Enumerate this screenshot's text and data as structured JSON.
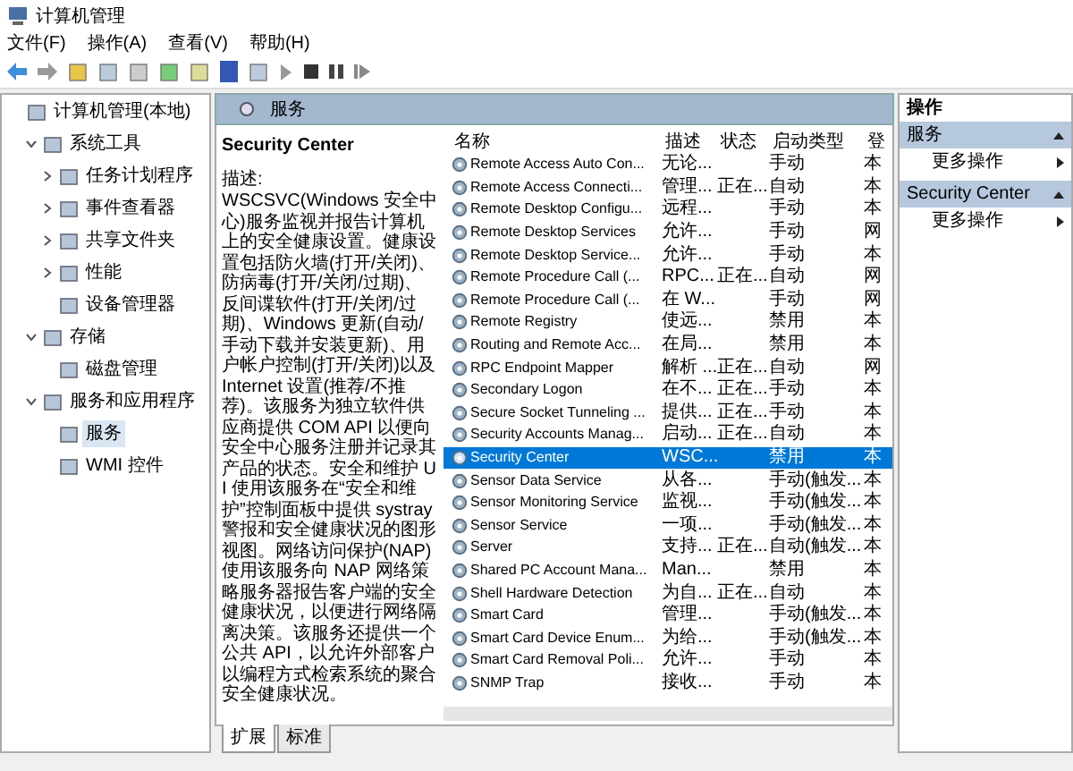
{
  "window": {
    "title": "计算机管理"
  },
  "menu": [
    "文件(F)",
    "操作(A)",
    "查看(V)",
    "帮助(H)"
  ],
  "tree": [
    {
      "label": "计算机管理(本地)",
      "selected": false,
      "children": [
        {
          "label": "系统工具",
          "expanded": true,
          "selected": false,
          "children": [
            {
              "label": "任务计划程序",
              "expanded": false,
              "selected": false
            },
            {
              "label": "事件查看器",
              "expanded": false,
              "selected": false
            },
            {
              "label": "共享文件夹",
              "expanded": false,
              "selected": false
            },
            {
              "label": "性能",
              "expanded": false,
              "selected": false
            },
            {
              "label": "设备管理器",
              "selected": false
            }
          ]
        },
        {
          "label": "存储",
          "expanded": true,
          "selected": false,
          "children": [
            {
              "label": "磁盘管理",
              "selected": false
            }
          ]
        },
        {
          "label": "服务和应用程序",
          "expanded": true,
          "selected": false,
          "children": [
            {
              "label": "服务",
              "selected": true
            },
            {
              "label": "WMI 控件",
              "selected": false
            }
          ]
        }
      ]
    }
  ],
  "panel": {
    "title": "服务"
  },
  "detail": {
    "name": "Security Center",
    "label": "描述:",
    "description": "WSCSVC(Windows 安全中心)服务监视并报告计算机上的安全健康设置。健康设置包括防火墙(打开/关闭)、防病毒(打开/关闭/过期)、反间谍软件(打开/关闭/过期)、Windows 更新(自动/手动下载并安装更新)、用户帐户控制(打开/关闭)以及 Internet 设置(推荐/不推荐)。该服务为独立软件供应商提供 COM API 以便向安全中心服务注册并记录其产品的状态。安全和维护 UI 使用该服务在“安全和维护”控制面板中提供 systray 警报和安全健康状况的图形视图。网络访问保护(NAP)使用该服务向 NAP 网络策略服务器报告客户端的安全健康状况，以便进行网络隔离决策。该服务还提供一个公共 API，以允许外部客户以编程方式检索系统的聚合安全健康状况。"
  },
  "columns": [
    "名称",
    "描述",
    "状态",
    "启动类型",
    "登"
  ],
  "rows": [
    {
      "name": "Remote Access Auto Con...",
      "description": "无论...",
      "status": "",
      "startup": "手动",
      "logon": "本",
      "selected": false
    },
    {
      "name": "Remote Access Connecti...",
      "description": "管理...",
      "status": "正在...",
      "startup": "自动",
      "logon": "本",
      "selected": false
    },
    {
      "name": "Remote Desktop Configu...",
      "description": "远程...",
      "status": "",
      "startup": "手动",
      "logon": "本",
      "selected": false
    },
    {
      "name": "Remote Desktop Services",
      "description": "允许...",
      "status": "",
      "startup": "手动",
      "logon": "网",
      "selected": false
    },
    {
      "name": "Remote Desktop Service...",
      "description": "允许...",
      "status": "",
      "startup": "手动",
      "logon": "本",
      "selected": false
    },
    {
      "name": "Remote Procedure Call (...",
      "description": "RPC...",
      "status": "正在...",
      "startup": "自动",
      "logon": "网",
      "selected": false
    },
    {
      "name": "Remote Procedure Call (...",
      "description": "在 W...",
      "status": "",
      "startup": "手动",
      "logon": "网",
      "selected": false
    },
    {
      "name": "Remote Registry",
      "description": "使远...",
      "status": "",
      "startup": "禁用",
      "logon": "本",
      "selected": false
    },
    {
      "name": "Routing and Remote Acc...",
      "description": "在局...",
      "status": "",
      "startup": "禁用",
      "logon": "本",
      "selected": false
    },
    {
      "name": "RPC Endpoint Mapper",
      "description": "解析 ...",
      "status": "正在...",
      "startup": "自动",
      "logon": "网",
      "selected": false
    },
    {
      "name": "Secondary Logon",
      "description": "在不...",
      "status": "正在...",
      "startup": "手动",
      "logon": "本",
      "selected": false
    },
    {
      "name": "Secure Socket Tunneling ...",
      "description": "提供...",
      "status": "正在...",
      "startup": "手动",
      "logon": "本",
      "selected": false
    },
    {
      "name": "Security Accounts Manag...",
      "description": "启动...",
      "status": "正在...",
      "startup": "自动",
      "logon": "本",
      "selected": false
    },
    {
      "name": "Security Center",
      "description": "WSC...",
      "status": "",
      "startup": "禁用",
      "logon": "本",
      "selected": true
    },
    {
      "name": "Sensor Data Service",
      "description": "从各...",
      "status": "",
      "startup": "手动(触发...",
      "logon": "本",
      "selected": false
    },
    {
      "name": "Sensor Monitoring Service",
      "description": "监视...",
      "status": "",
      "startup": "手动(触发...",
      "logon": "本",
      "selected": false
    },
    {
      "name": "Sensor Service",
      "description": "一项...",
      "status": "",
      "startup": "手动(触发...",
      "logon": "本",
      "selected": false
    },
    {
      "name": "Server",
      "description": "支持...",
      "status": "正在...",
      "startup": "自动(触发...",
      "logon": "本",
      "selected": false
    },
    {
      "name": "Shared PC Account Mana...",
      "description": "Man...",
      "status": "",
      "startup": "禁用",
      "logon": "本",
      "selected": false
    },
    {
      "name": "Shell Hardware Detection",
      "description": "为自...",
      "status": "正在...",
      "startup": "自动",
      "logon": "本",
      "selected": false
    },
    {
      "name": "Smart Card",
      "description": "管理...",
      "status": "",
      "startup": "手动(触发...",
      "logon": "本",
      "selected": false
    },
    {
      "name": "Smart Card Device Enum...",
      "description": "为给...",
      "status": "",
      "startup": "手动(触发...",
      "logon": "本",
      "selected": false
    },
    {
      "name": "Smart Card Removal Poli...",
      "description": "允许...",
      "status": "",
      "startup": "手动",
      "logon": "本",
      "selected": false
    },
    {
      "name": "SNMP Trap",
      "description": "接收...",
      "status": "",
      "startup": "手动",
      "logon": "本",
      "selected": false
    }
  ],
  "tabs": [
    {
      "label": "扩展",
      "selected": true
    },
    {
      "label": "标准",
      "selected": false
    }
  ],
  "actions": {
    "title": "操作",
    "sections": [
      {
        "title": "服务",
        "items": [
          "更多操作"
        ]
      },
      {
        "title": "Security Center",
        "items": [
          "更多操作"
        ]
      }
    ]
  }
}
